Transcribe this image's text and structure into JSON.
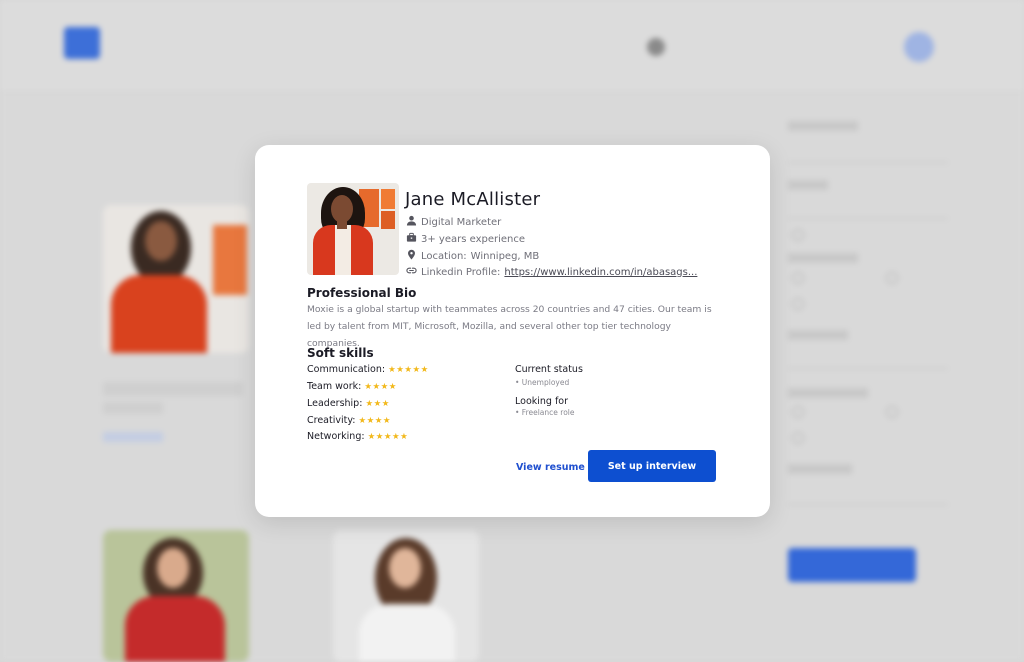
{
  "profile": {
    "name": "Jane McAllister",
    "title": "Digital Marketer",
    "experience": "3+ years experience",
    "location_label": "Location:",
    "location_value": "Winnipeg, MB",
    "linkedin_label": "Linkedin Profile:",
    "linkedin_url": "https://www.linkedin.com/in/abasags..."
  },
  "bio": {
    "heading": "Professional Bio",
    "text": "Moxie is a global startup with teammates across 20 countries and 47 cities. Our team is led by talent from MIT, Microsoft, Mozilla, and several other top tier technology companies."
  },
  "skills": {
    "heading": "Soft skills",
    "items": [
      {
        "label": "Communication:",
        "stars": "★★★★★"
      },
      {
        "label": "Team work:",
        "stars": "★★★★"
      },
      {
        "label": "Leadership:",
        "stars": "★★★"
      },
      {
        "label": "Creativity:",
        "stars": "★★★★"
      },
      {
        "label": "Networking:",
        "stars": "★★★★★"
      }
    ]
  },
  "status": {
    "current_heading": "Current status",
    "current_value": "• Unemployed",
    "looking_heading": "Looking for",
    "looking_value": "• Freelance  role"
  },
  "actions": {
    "view_resume": "View resume →",
    "setup_interview": "Set up interview"
  },
  "colors": {
    "primary": "#0d4fd0",
    "star": "#f2b81a",
    "backdrop": "#d6d6d6"
  },
  "icons": [
    "person-icon",
    "briefcase-icon",
    "location-pin-icon",
    "link-icon"
  ]
}
